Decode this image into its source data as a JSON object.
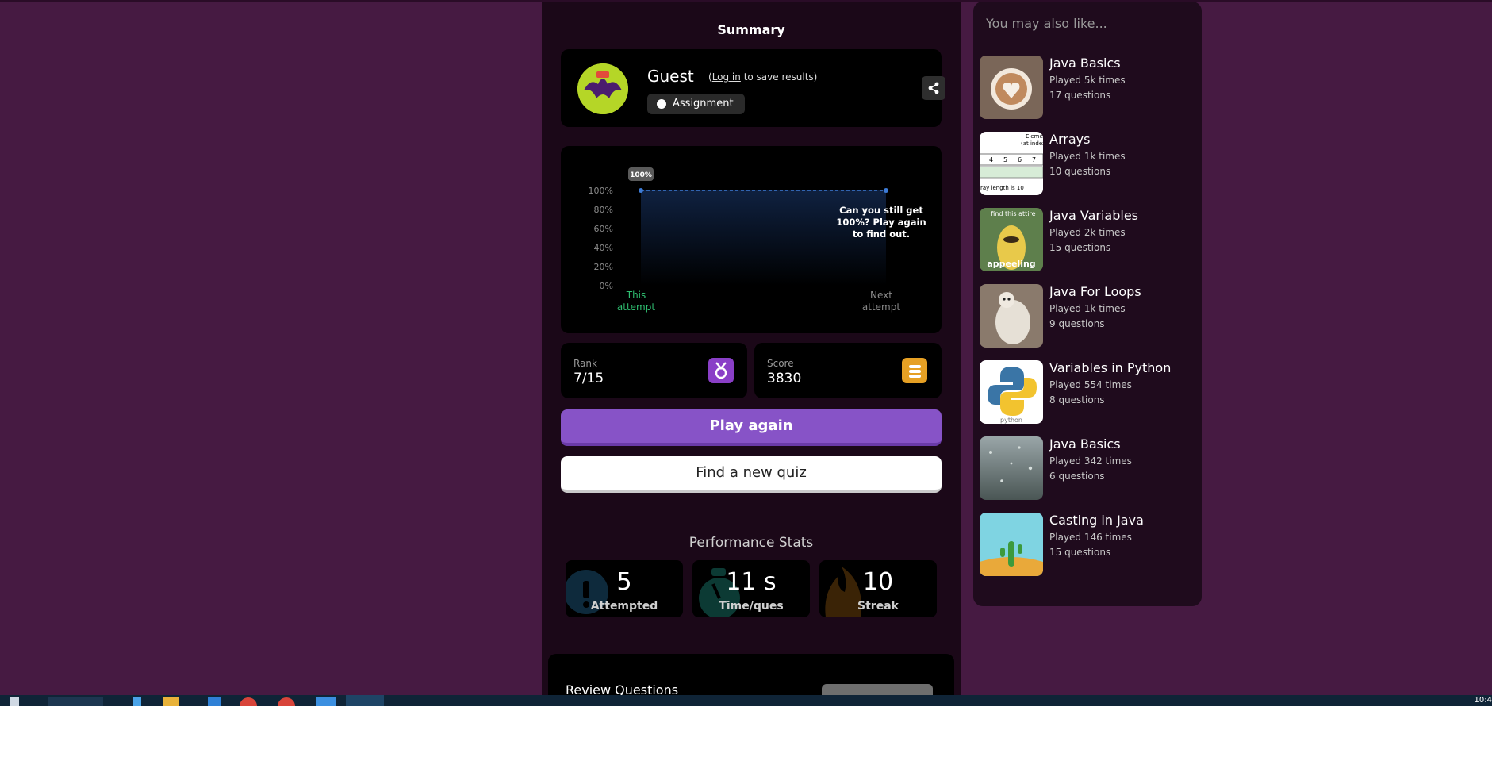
{
  "summary": {
    "title": "Summary",
    "guest_name": "Guest",
    "login_prefix": "(",
    "login_link": "Log in",
    "login_suffix": " to save results)",
    "assignment_label": "Assignment"
  },
  "chart_data": {
    "type": "line",
    "x": [
      "This attempt",
      "Next attempt"
    ],
    "series": [
      {
        "values": [
          100,
          100
        ]
      }
    ],
    "y_ticks": [
      "100%",
      "80%",
      "60%",
      "40%",
      "20%",
      "0%"
    ],
    "ylim": [
      0,
      100
    ],
    "point_label": "100%",
    "annotation": "Can you still get 100%? Play again to find out.",
    "x_label_lines": [
      [
        "This",
        "attempt"
      ],
      [
        "Next",
        "attempt"
      ]
    ],
    "highlight_color": "#2fbf71",
    "line_color": "#3d7bd6"
  },
  "rank": {
    "label": "Rank",
    "value": "7/15"
  },
  "score": {
    "label": "Score",
    "value": "3830"
  },
  "buttons": {
    "play_again": "Play again",
    "find_quiz": "Find a new quiz"
  },
  "performance": {
    "title": "Performance Stats",
    "items": [
      {
        "value": "5",
        "label": "Attempted",
        "icon": "exclamation-icon"
      },
      {
        "value": "11 s",
        "label": "Time/ques",
        "icon": "stopwatch-icon"
      },
      {
        "value": "10",
        "label": "Streak",
        "icon": "fire-icon"
      }
    ]
  },
  "review": {
    "title": "Review Questions"
  },
  "recommendations": {
    "title": "You may also like...",
    "items": [
      {
        "name": "Java Basics",
        "plays": "Played 5k times",
        "questions": "17 questions",
        "thumb": "coffee"
      },
      {
        "name": "Arrays",
        "plays": "Played 1k times",
        "questions": "10 questions",
        "thumb": "array-diagram"
      },
      {
        "name": "Java Variables",
        "plays": "Played 2k times",
        "questions": "15 questions",
        "thumb": "banana-meme"
      },
      {
        "name": "Java For Loops",
        "plays": "Played 1k times",
        "questions": "9 questions",
        "thumb": "dog"
      },
      {
        "name": "Variables in Python",
        "plays": "Played 554 times",
        "questions": "8 questions",
        "thumb": "python-logo"
      },
      {
        "name": "Java Basics",
        "plays": "Played 342 times",
        "questions": "6 questions",
        "thumb": "rain-window"
      },
      {
        "name": "Casting in Java",
        "plays": "Played 146 times",
        "questions": "15 questions",
        "thumb": "cactus"
      }
    ],
    "thumb_texts": {
      "array_caption": "ray length is 10",
      "array_cells": [
        "4",
        "5",
        "6",
        "7"
      ],
      "array_elem": "Eleme",
      "array_index": "(at index",
      "meme_top": "i find this attire",
      "meme_bottom": "appeeling",
      "python": "python"
    }
  },
  "taskbar": {
    "clock": "10:4"
  }
}
